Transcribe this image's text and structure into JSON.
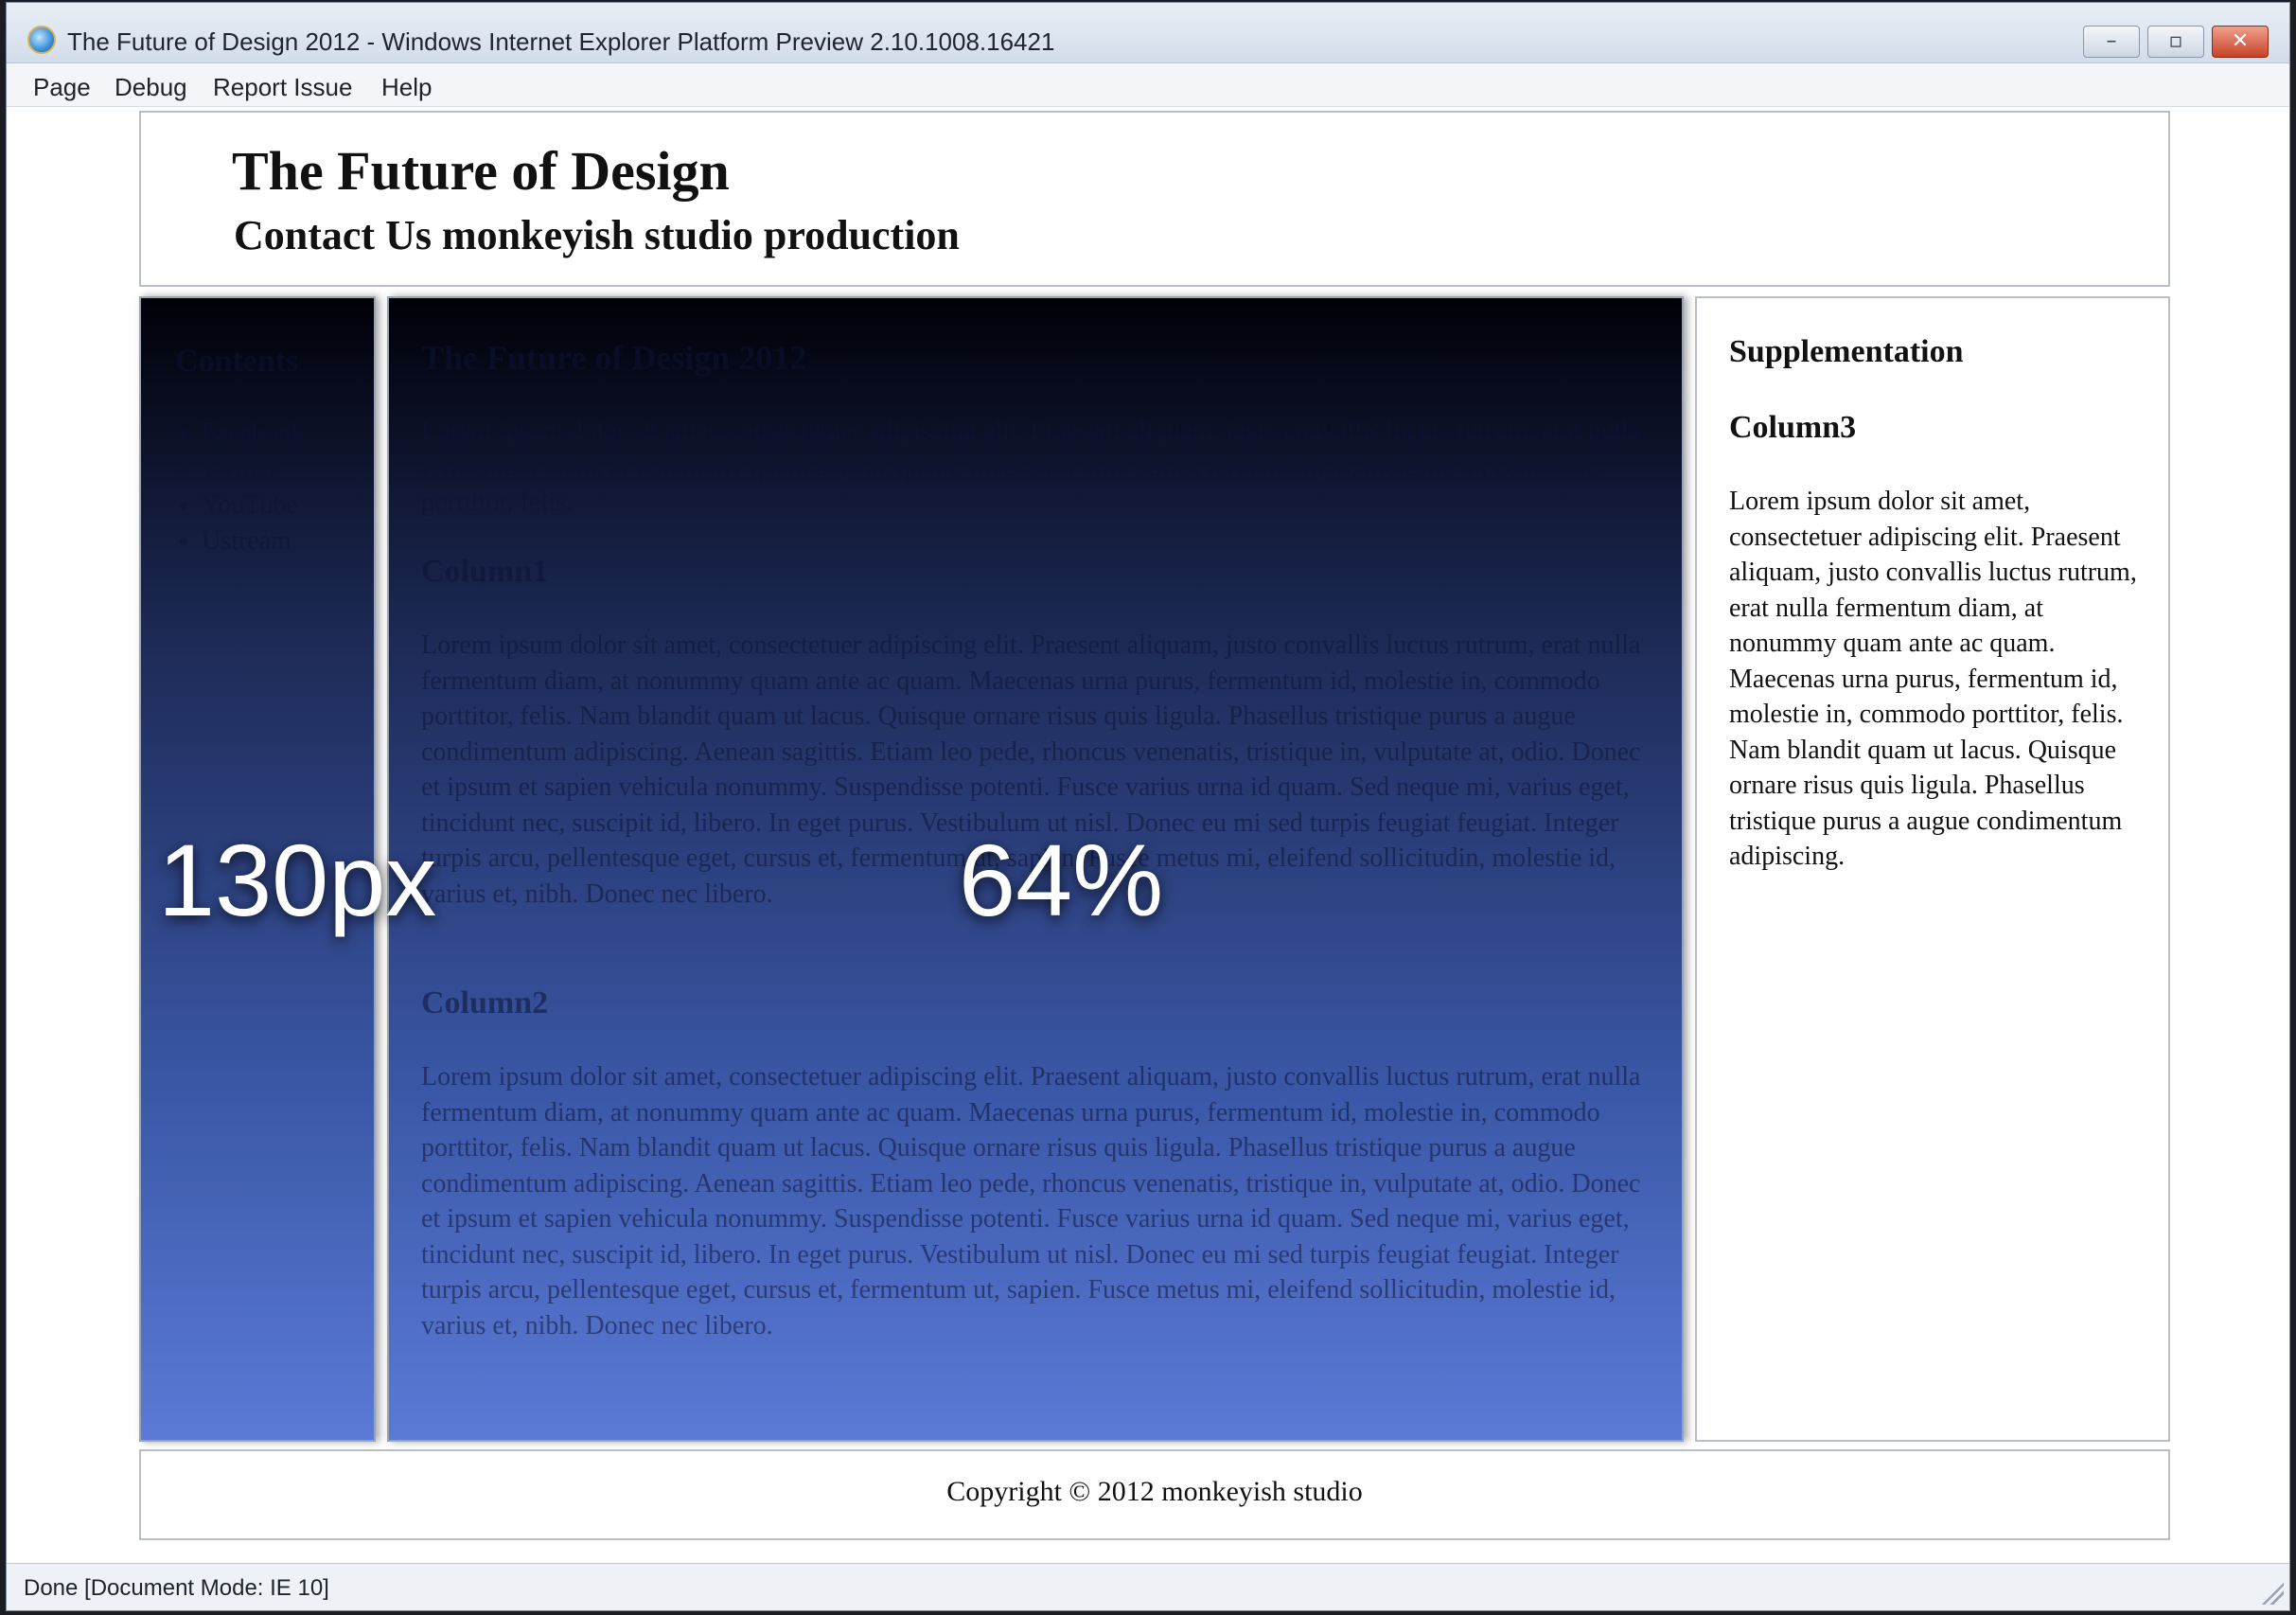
{
  "window": {
    "title": "The Future of Design 2012 - Windows Internet Explorer Platform Preview 2.10.1008.16421",
    "app_icon": "ie-icon",
    "controls": {
      "minimize": "–",
      "maximize": "▫",
      "close": "✕"
    }
  },
  "menubar": {
    "items": [
      {
        "label": "Page"
      },
      {
        "label": "Debug"
      },
      {
        "label": "Report Issue"
      },
      {
        "label": "Help"
      }
    ]
  },
  "page": {
    "header": {
      "title": "The Future of Design",
      "subtitle": "Contact Us monkeyish studio production"
    },
    "left_column": {
      "heading": "Contents",
      "nav_items": [
        {
          "label": "Facebook"
        },
        {
          "label": "Twitter"
        },
        {
          "label": "YouTube"
        },
        {
          "label": "Ustream"
        }
      ],
      "overlay_label": "130px"
    },
    "main_column": {
      "heading": "The Future of Design 2012",
      "intro": "Lorem ipsum dolor sit amet, consectetuer adipiscing elit. Praesent aliquam, justo convallis luctus rutrum, erat nulla fermentum diam, at nonummy quam ante ac quam. Maecenas urna purus, fermentum id, molestie in, commodo porttitor, felis.",
      "sections": [
        {
          "heading": "Column1",
          "text": "Lorem ipsum dolor sit amet, consectetuer adipiscing elit. Praesent aliquam, justo convallis luctus rutrum, erat nulla fermentum diam, at nonummy quam ante ac quam. Maecenas urna purus, fermentum id, molestie in, commodo porttitor, felis. Nam blandit quam ut lacus. Quisque ornare risus quis ligula. Phasellus tristique purus a augue condimentum adipiscing. Aenean sagittis. Etiam leo pede, rhoncus venenatis, tristique in, vulputate at, odio. Donec et ipsum et sapien vehicula nonummy. Suspendisse potenti. Fusce varius urna id quam. Sed neque mi, varius eget, tincidunt nec, suscipit id, libero. In eget purus. Vestibulum ut nisl. Donec eu mi sed turpis feugiat feugiat. Integer turpis arcu, pellentesque eget, cursus et, fermentum ut, sapien. Fusce metus mi, eleifend sollicitudin, molestie id, varius et, nibh. Donec nec libero."
        },
        {
          "heading": "Column2",
          "text": "Lorem ipsum dolor sit amet, consectetuer adipiscing elit. Praesent aliquam, justo convallis luctus rutrum, erat nulla fermentum diam, at nonummy quam ante ac quam. Maecenas urna purus, fermentum id, molestie in, commodo porttitor, felis. Nam blandit quam ut lacus. Quisque ornare risus quis ligula. Phasellus tristique purus a augue condimentum adipiscing. Aenean sagittis. Etiam leo pede, rhoncus venenatis, tristique in, vulputate at, odio. Donec et ipsum et sapien vehicula nonummy. Suspendisse potenti. Fusce varius urna id quam. Sed neque mi, varius eget, tincidunt nec, suscipit id, libero. In eget purus. Vestibulum ut nisl. Donec eu mi sed turpis feugiat feugiat. Integer turpis arcu, pellentesque eget, cursus et, fermentum ut, sapien. Fusce metus mi, eleifend sollicitudin, molestie id, varius et, nibh. Donec nec libero."
        }
      ],
      "overlay_label": "64%"
    },
    "right_column": {
      "heading": "Supplementation",
      "subheading": "Column3",
      "text": "Lorem ipsum dolor sit amet, consectetuer adipiscing elit. Praesent aliquam, justo convallis luctus rutrum, erat nulla fermentum diam, at nonummy quam ante ac quam. Maecenas urna purus, fermentum id, molestie in, commodo porttitor, felis. Nam blandit quam ut lacus. Quisque ornare risus quis ligula. Phasellus tristique purus a augue condimentum adipiscing."
    },
    "footer": {
      "text": "Copyright © 2012 monkeyish studio"
    }
  },
  "statusbar": {
    "text": "Done [Document Mode: IE 10]"
  },
  "colors": {
    "column_gradient_top": "#000008",
    "column_gradient_bottom": "#5b7ad6",
    "close_button": "#c7432a"
  }
}
